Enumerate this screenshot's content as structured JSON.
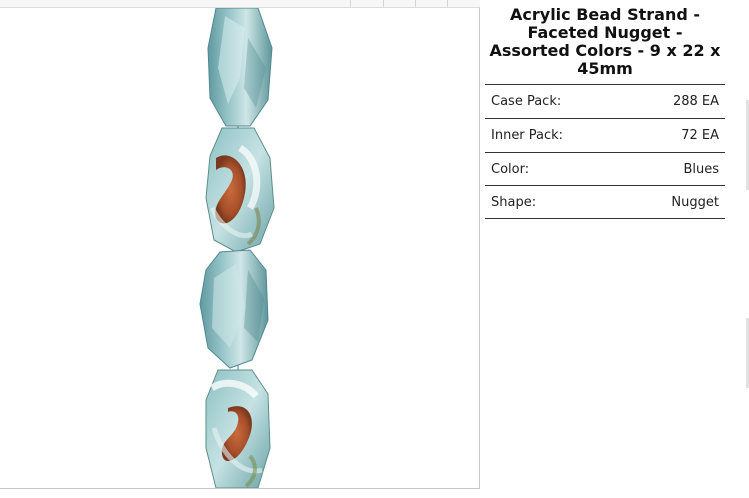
{
  "product": {
    "title": "Acrylic Bead Strand - Faceted Nugget - Assorted Colors - 9 x 22 x 45mm",
    "image_alt": "Acrylic bead strand photo"
  },
  "specs": [
    {
      "label": "Case Pack:",
      "value": "288 EA"
    },
    {
      "label": "Inner Pack:",
      "value": "72 EA"
    },
    {
      "label": "Color:",
      "value": "Blues"
    },
    {
      "label": "Shape:",
      "value": "Nugget"
    }
  ],
  "colors": {
    "bead_aqua": "#7fb3b8",
    "bead_aqua_light": "#b9dadc",
    "bead_rust": "#b5542c",
    "divider": "#333333"
  }
}
